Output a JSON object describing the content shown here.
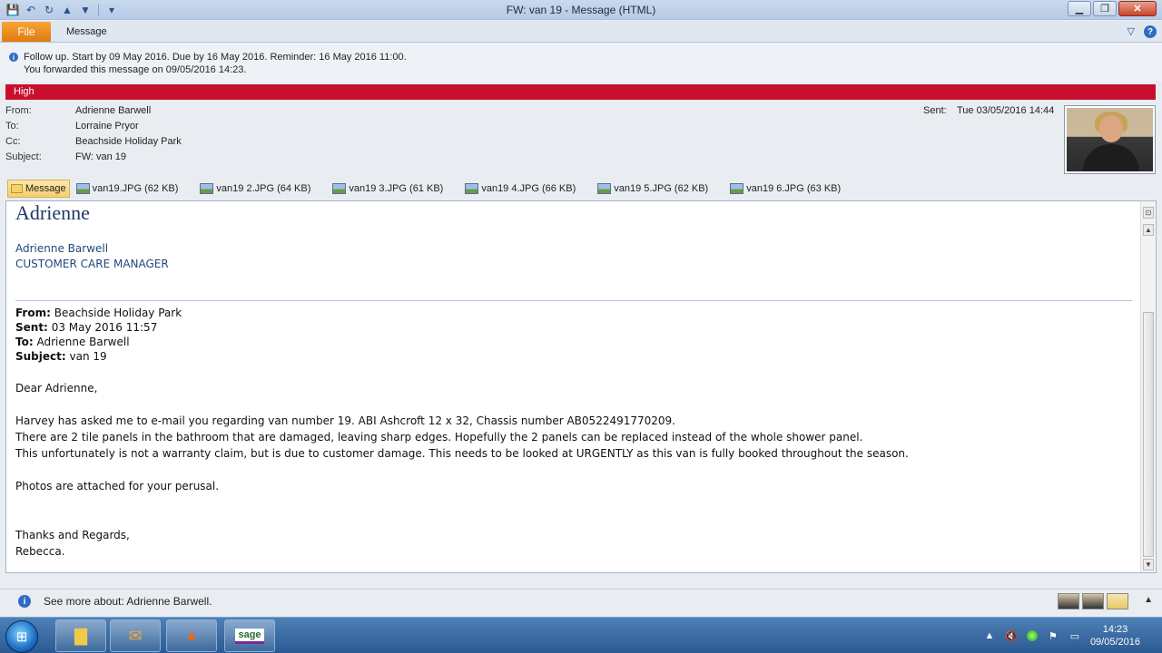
{
  "window": {
    "title": "FW: van 19  -  Message (HTML)",
    "minimize": "▁",
    "maximize": "❐",
    "close": "✕"
  },
  "ribbon": {
    "file_tab": "File",
    "message_tab": "Message",
    "help": "?"
  },
  "infobar": {
    "line1": "Follow up.  Start by 09 May 2016.  Due by 16 May 2016.  Reminder: 16 May 2016 11:00.",
    "line2": "You forwarded this message on 09/05/2016 14:23."
  },
  "priority": {
    "label": "High",
    "color": "#c8102e"
  },
  "header": {
    "from_label": "From:",
    "from": "Adrienne Barwell",
    "to_label": "To:",
    "to": "Lorraine Pryor",
    "cc_label": "Cc:",
    "cc": "Beachside Holiday Park",
    "subject_label": "Subject:",
    "subject": "FW: van 19",
    "sent_label": "Sent:",
    "sent": "Tue 03/05/2016 14:44"
  },
  "attachments": {
    "message_tab": "Message",
    "files": [
      "van19.JPG (62 KB)",
      "van19 2.JPG (64 KB)",
      "van19 3.JPG (61 KB)",
      "van19 4.JPG (66 KB)",
      "van19 5.JPG (62 KB)",
      "van19 6.JPG (63 KB)"
    ]
  },
  "body": {
    "sig_first": "Adrienne",
    "sig_name": "Adrienne Barwell",
    "sig_title": "CUSTOMER CARE MANAGER",
    "fwd_from_label": "From:",
    "fwd_from": "Beachside Holiday Park",
    "fwd_sent_label": "Sent:",
    "fwd_sent": "03 May 2016 11:57",
    "fwd_to_label": "To:",
    "fwd_to": "Adrienne Barwell",
    "fwd_subject_label": "Subject:",
    "fwd_subject": "van 19",
    "greeting": "Dear Adrienne,",
    "p1": "Harvey has asked me to e-mail you regarding van number 19. ABI Ashcroft 12 x 32, Chassis number AB0522491770209.",
    "p2": "There are 2 tile panels in the bathroom that are damaged, leaving sharp edges. Hopefully the 2 panels can be replaced instead of the whole shower panel.",
    "p3": "This unfortunately is not a warranty claim, but is due to customer damage. This needs to be looked at URGENTLY as this van is fully booked throughout the season.",
    "p4": "Photos are attached for your perusal.",
    "closing": "Thanks and Regards,",
    "signoff": "Rebecca."
  },
  "peoplebar": {
    "text": "See more about: Adrienne Barwell."
  },
  "taskbar": {
    "start": "⊞",
    "apps": [
      "explorer-icon",
      "outlook-icon",
      "firefox-icon",
      "sage-icon"
    ],
    "sage_label": "sage",
    "time": "14:23",
    "date": "09/05/2016"
  }
}
